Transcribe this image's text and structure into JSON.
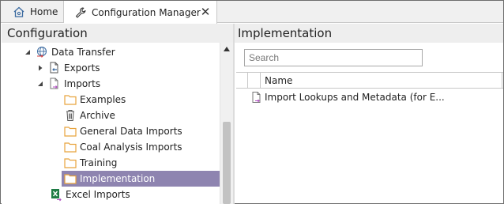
{
  "tabs": [
    {
      "label": "Home",
      "icon": "home-icon"
    },
    {
      "label": "Configuration Manager",
      "icon": "wrench-icon"
    }
  ],
  "left_panel": {
    "title": "Configuration",
    "tree": [
      {
        "label": "Data Transfer",
        "icon": "globe-transfer-icon",
        "expander": "expanded"
      },
      {
        "label": "Exports",
        "icon": "export-document-icon",
        "expander": "collapsed"
      },
      {
        "label": "Imports",
        "icon": "import-document-icon",
        "expander": "expanded"
      },
      {
        "label": "Examples",
        "icon": "folder-icon",
        "expander": "none"
      },
      {
        "label": "Archive",
        "icon": "trash-icon",
        "expander": "none"
      },
      {
        "label": "General Data Imports",
        "icon": "folder-icon",
        "expander": "none"
      },
      {
        "label": "Coal Analysis Imports",
        "icon": "folder-icon",
        "expander": "none"
      },
      {
        "label": "Training",
        "icon": "folder-icon",
        "expander": "none"
      },
      {
        "label": "Implementation",
        "icon": "folder-icon",
        "expander": "none",
        "selected": true
      },
      {
        "label": "Excel Imports",
        "icon": "excel-icon",
        "expander": "none"
      }
    ]
  },
  "right_panel": {
    "title": "Implementation",
    "search": {
      "placeholder": "Search",
      "value": ""
    },
    "columns": [
      "Name"
    ],
    "rows": [
      {
        "name": "Import Lookups and Metadata (for E...",
        "icon": "import-document-icon"
      }
    ]
  },
  "colors": {
    "selection": "#8e84b0",
    "folder": "#e8a33d",
    "header_bg": "#eeeeee",
    "tab_bg": "#f0f0f0"
  }
}
